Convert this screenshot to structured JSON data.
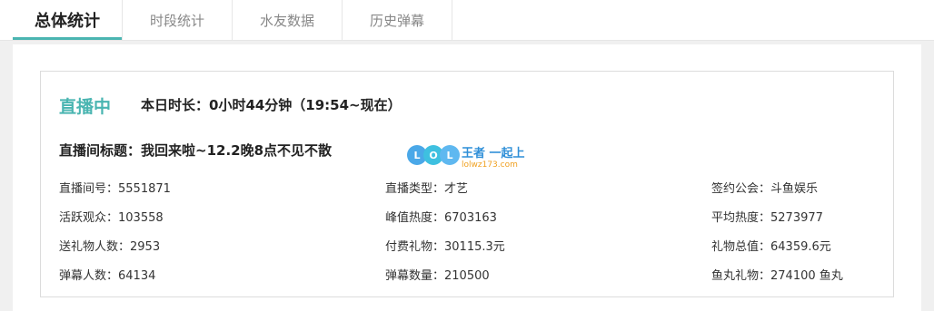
{
  "tabs": [
    {
      "label": "总体统计",
      "active": true
    },
    {
      "label": "时段统计",
      "active": false
    },
    {
      "label": "水友数据",
      "active": false
    },
    {
      "label": "历史弹幕",
      "active": false
    }
  ],
  "accent_color": "#4ab5b1",
  "live": {
    "status": "直播中",
    "duration": "本日时长：0小时44分钟（19:54~现在）",
    "room_title": "直播间标题：我回来啦~12.2晚8点不见不散"
  },
  "watermark": {
    "letters": [
      "L",
      "O",
      "L"
    ],
    "brand": "王者 一起上",
    "url": "lolwz173.com"
  },
  "stats": {
    "col1": [
      "直播间号：5551871",
      "活跃观众：103558",
      "送礼物人数：2953",
      "弹幕人数：64134"
    ],
    "col2": [
      "直播类型：才艺",
      "峰值热度：6703163",
      "付费礼物：30115.3元",
      "弹幕数量：210500"
    ],
    "col3": [
      "签约公会：斗鱼娱乐",
      "平均热度：5273977",
      "礼物总值：64359.6元",
      "鱼丸礼物：274100 鱼丸"
    ]
  }
}
